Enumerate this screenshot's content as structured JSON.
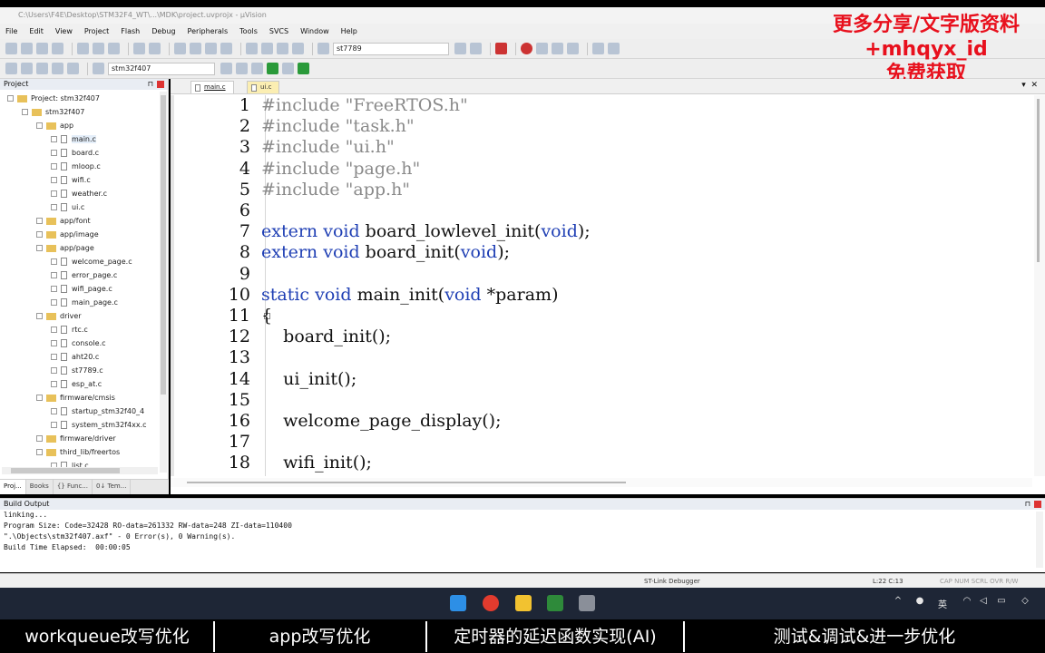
{
  "window": {
    "title": "C:\\Users\\F4E\\Desktop\\STM32F4_WT\\...\\MDK\\project.uvprojx - µVision"
  },
  "menu": [
    "File",
    "Edit",
    "View",
    "Project",
    "Flash",
    "Debug",
    "Peripherals",
    "Tools",
    "SVCS",
    "Window",
    "Help"
  ],
  "toolbar": {
    "search_combo": "st7789",
    "target_combo": "stm32f407"
  },
  "promo": {
    "line1": "更多分享/文字版资料",
    "line2": "+mhqyx_id",
    "line3": "免费获取"
  },
  "project_panel": {
    "title": "Project",
    "tree": [
      {
        "label": "Project: stm32f407",
        "depth": 0,
        "kind": "root"
      },
      {
        "label": "stm32f407",
        "depth": 1,
        "kind": "folder"
      },
      {
        "label": "app",
        "depth": 2,
        "kind": "folder"
      },
      {
        "label": "main.c",
        "depth": 3,
        "kind": "file",
        "selected": true
      },
      {
        "label": "board.c",
        "depth": 3,
        "kind": "file"
      },
      {
        "label": "mloop.c",
        "depth": 3,
        "kind": "file"
      },
      {
        "label": "wifi.c",
        "depth": 3,
        "kind": "file"
      },
      {
        "label": "weather.c",
        "depth": 3,
        "kind": "file"
      },
      {
        "label": "ui.c",
        "depth": 3,
        "kind": "file"
      },
      {
        "label": "app/font",
        "depth": 2,
        "kind": "folder"
      },
      {
        "label": "app/image",
        "depth": 2,
        "kind": "folder"
      },
      {
        "label": "app/page",
        "depth": 2,
        "kind": "folder"
      },
      {
        "label": "welcome_page.c",
        "depth": 3,
        "kind": "file"
      },
      {
        "label": "error_page.c",
        "depth": 3,
        "kind": "file"
      },
      {
        "label": "wifi_page.c",
        "depth": 3,
        "kind": "file"
      },
      {
        "label": "main_page.c",
        "depth": 3,
        "kind": "file"
      },
      {
        "label": "driver",
        "depth": 2,
        "kind": "folder"
      },
      {
        "label": "rtc.c",
        "depth": 3,
        "kind": "file"
      },
      {
        "label": "console.c",
        "depth": 3,
        "kind": "file"
      },
      {
        "label": "aht20.c",
        "depth": 3,
        "kind": "file"
      },
      {
        "label": "st7789.c",
        "depth": 3,
        "kind": "file"
      },
      {
        "label": "esp_at.c",
        "depth": 3,
        "kind": "file"
      },
      {
        "label": "firmware/cmsis",
        "depth": 2,
        "kind": "folder"
      },
      {
        "label": "startup_stm32f40_4",
        "depth": 3,
        "kind": "file"
      },
      {
        "label": "system_stm32f4xx.c",
        "depth": 3,
        "kind": "file"
      },
      {
        "label": "firmware/driver",
        "depth": 2,
        "kind": "folder"
      },
      {
        "label": "third_lib/freertos",
        "depth": 2,
        "kind": "folder"
      },
      {
        "label": "list.c",
        "depth": 3,
        "kind": "file"
      }
    ],
    "bottom_tabs": [
      "Proj...",
      "Books",
      "{} Func...",
      "0↓ Tem..."
    ]
  },
  "editor": {
    "tabs": [
      "main.c",
      "ui.c"
    ],
    "lines": [
      {
        "n": "1",
        "text": "#include \"FreeRTOS.h\""
      },
      {
        "n": "2",
        "text": "#include \"task.h\""
      },
      {
        "n": "3",
        "text": "#include \"ui.h\""
      },
      {
        "n": "4",
        "text": "#include \"page.h\""
      },
      {
        "n": "5",
        "text": "#include \"app.h\""
      },
      {
        "n": "6",
        "text": ""
      },
      {
        "n": "7",
        "text": "extern void board_lowlevel_init(void);"
      },
      {
        "n": "8",
        "text": "extern void board_init(void);"
      },
      {
        "n": "9",
        "text": ""
      },
      {
        "n": "10",
        "text": "static void main_init(void *param)"
      },
      {
        "n": "11",
        "text": "{"
      },
      {
        "n": "12",
        "text": "    board_init();"
      },
      {
        "n": "13",
        "text": ""
      },
      {
        "n": "14",
        "text": "    ui_init();"
      },
      {
        "n": "15",
        "text": ""
      },
      {
        "n": "16",
        "text": "    welcome_page_display();"
      },
      {
        "n": "17",
        "text": ""
      },
      {
        "n": "18",
        "text": "    wifi_init();"
      }
    ],
    "colors": {
      "preprocessor": "#8a8a8a",
      "keyword": "#1f3fb4",
      "text": "#111111"
    }
  },
  "build_output": {
    "title": "Build Output",
    "lines": [
      "linking...",
      "Program Size: Code=32428 RO-data=261332 RW-data=248 ZI-data=110400",
      "\".\\Objects\\stm32f407.axf\" - 0 Error(s), 0 Warning(s).",
      "Build Time Elapsed:  00:00:05"
    ]
  },
  "status_bar": {
    "debugger": "ST-Link Debugger",
    "cursor": "L:22 C:13",
    "caps": "CAP NUM SCRL OVR R/W"
  },
  "taskbar": {
    "ime": "英"
  },
  "chapters": [
    "workqueue改写优化",
    "app改写优化",
    "定时器的延迟函数实现(AI)",
    "测试&调试&进一步优化"
  ]
}
